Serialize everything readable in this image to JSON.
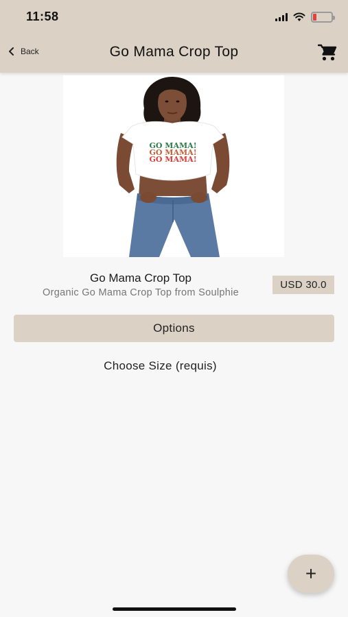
{
  "status_bar": {
    "time": "11:58",
    "battery_level": 0.2,
    "battery_color": "#e0433b"
  },
  "nav": {
    "back_label": "Back",
    "title": "Go Mama Crop Top",
    "cart_icon": "cart-icon"
  },
  "product": {
    "image_alt_icon": "product-photo",
    "name": "Go Mama Crop Top",
    "description": "Organic Go Mama Crop Top from Soulphie",
    "price": "USD 30.0",
    "shirt_print": [
      "GO MAMA!",
      "GO MAMA!",
      "GO MAMA!"
    ]
  },
  "options": {
    "label": "Options",
    "size_label": "Choose Size (requis)"
  },
  "fab": {
    "label": "+"
  },
  "theme": {
    "accent": "#dbd1c5",
    "background": "#f7f7f7"
  }
}
